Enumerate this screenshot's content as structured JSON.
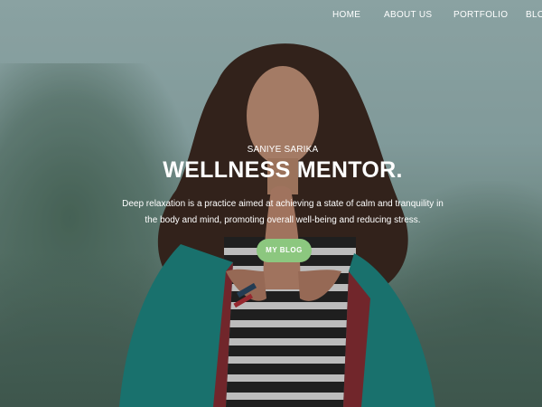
{
  "nav": {
    "items": [
      {
        "label": "HOME"
      },
      {
        "label": "ABOUT US"
      },
      {
        "label": "PORTFOLIO"
      },
      {
        "label": "BLOG"
      }
    ]
  },
  "hero": {
    "subtitle": "SANIYE SARIKA",
    "title": "WELLNESS MENTOR.",
    "description": "Deep relaxation is a practice aimed at achieving a state of calm and tranquility in the body and mind, promoting overall well-being and reducing stress.",
    "cta_label": "MY BLOG"
  },
  "colors": {
    "cta_background": "#8cc77f",
    "text": "#ffffff"
  }
}
